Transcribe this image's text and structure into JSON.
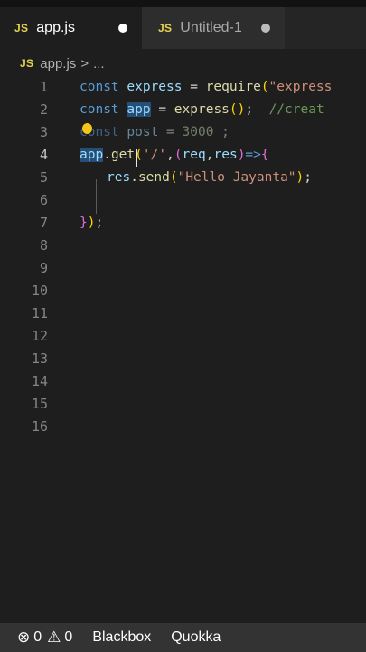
{
  "tabs": [
    {
      "icon": "JS",
      "label": "app.js",
      "active": true,
      "unsaved": true
    },
    {
      "icon": "JS",
      "label": "Untitled-1",
      "active": false,
      "unsaved": true
    }
  ],
  "breadcrumb": {
    "icon": "JS",
    "file": "app.js",
    "separator": ">",
    "more": "..."
  },
  "editor": {
    "line_numbers": [
      "1",
      "2",
      "3",
      "4",
      "5",
      "6",
      "7",
      "8",
      "9",
      "10",
      "11",
      "12",
      "13",
      "14",
      "15",
      "16"
    ],
    "lines": {
      "l1": {
        "kw": "const",
        "var": "express",
        "eq": "=",
        "fn": "require",
        "open": "(",
        "str": "\"express"
      },
      "l2": {
        "kw": "const",
        "var": "app",
        "eq": "=",
        "fn": "express",
        "parens": "()",
        "semi": ";",
        "comment": "//creat"
      },
      "l3": {
        "kw": "const",
        "var": "post",
        "eq": "=",
        "num": "3000",
        "semi": ";"
      },
      "l4": {
        "obj": "app",
        "dot": ".",
        "method": "get",
        "open": "(",
        "str": "'/'",
        "comma": ",",
        "open2": "(",
        "p1": "req",
        "comma2": ",",
        "p2": "res",
        "close2": ")",
        "arrow": "=>",
        "brace": "{"
      },
      "l5": {
        "obj": "res",
        "dot": ".",
        "method": "send",
        "open": "(",
        "str": "\"Hello Jayanta\"",
        "close": ")",
        "semi": ";"
      },
      "l7": {
        "brace": "}",
        "close": ")",
        "semi": ";"
      }
    }
  },
  "statusbar": {
    "errors_icon": "error-circle-icon",
    "errors": "0",
    "warnings_icon": "warning-triangle-icon",
    "warnings": "0",
    "item1": "Blackbox",
    "item2": "Quokka"
  },
  "colors": {
    "keyword": "#569cd6",
    "variable": "#9cdcfe",
    "function": "#dcdcaa",
    "string": "#ce9178",
    "number": "#b5cea8",
    "comment": "#6a9955",
    "js_icon": "#e8d44d"
  }
}
